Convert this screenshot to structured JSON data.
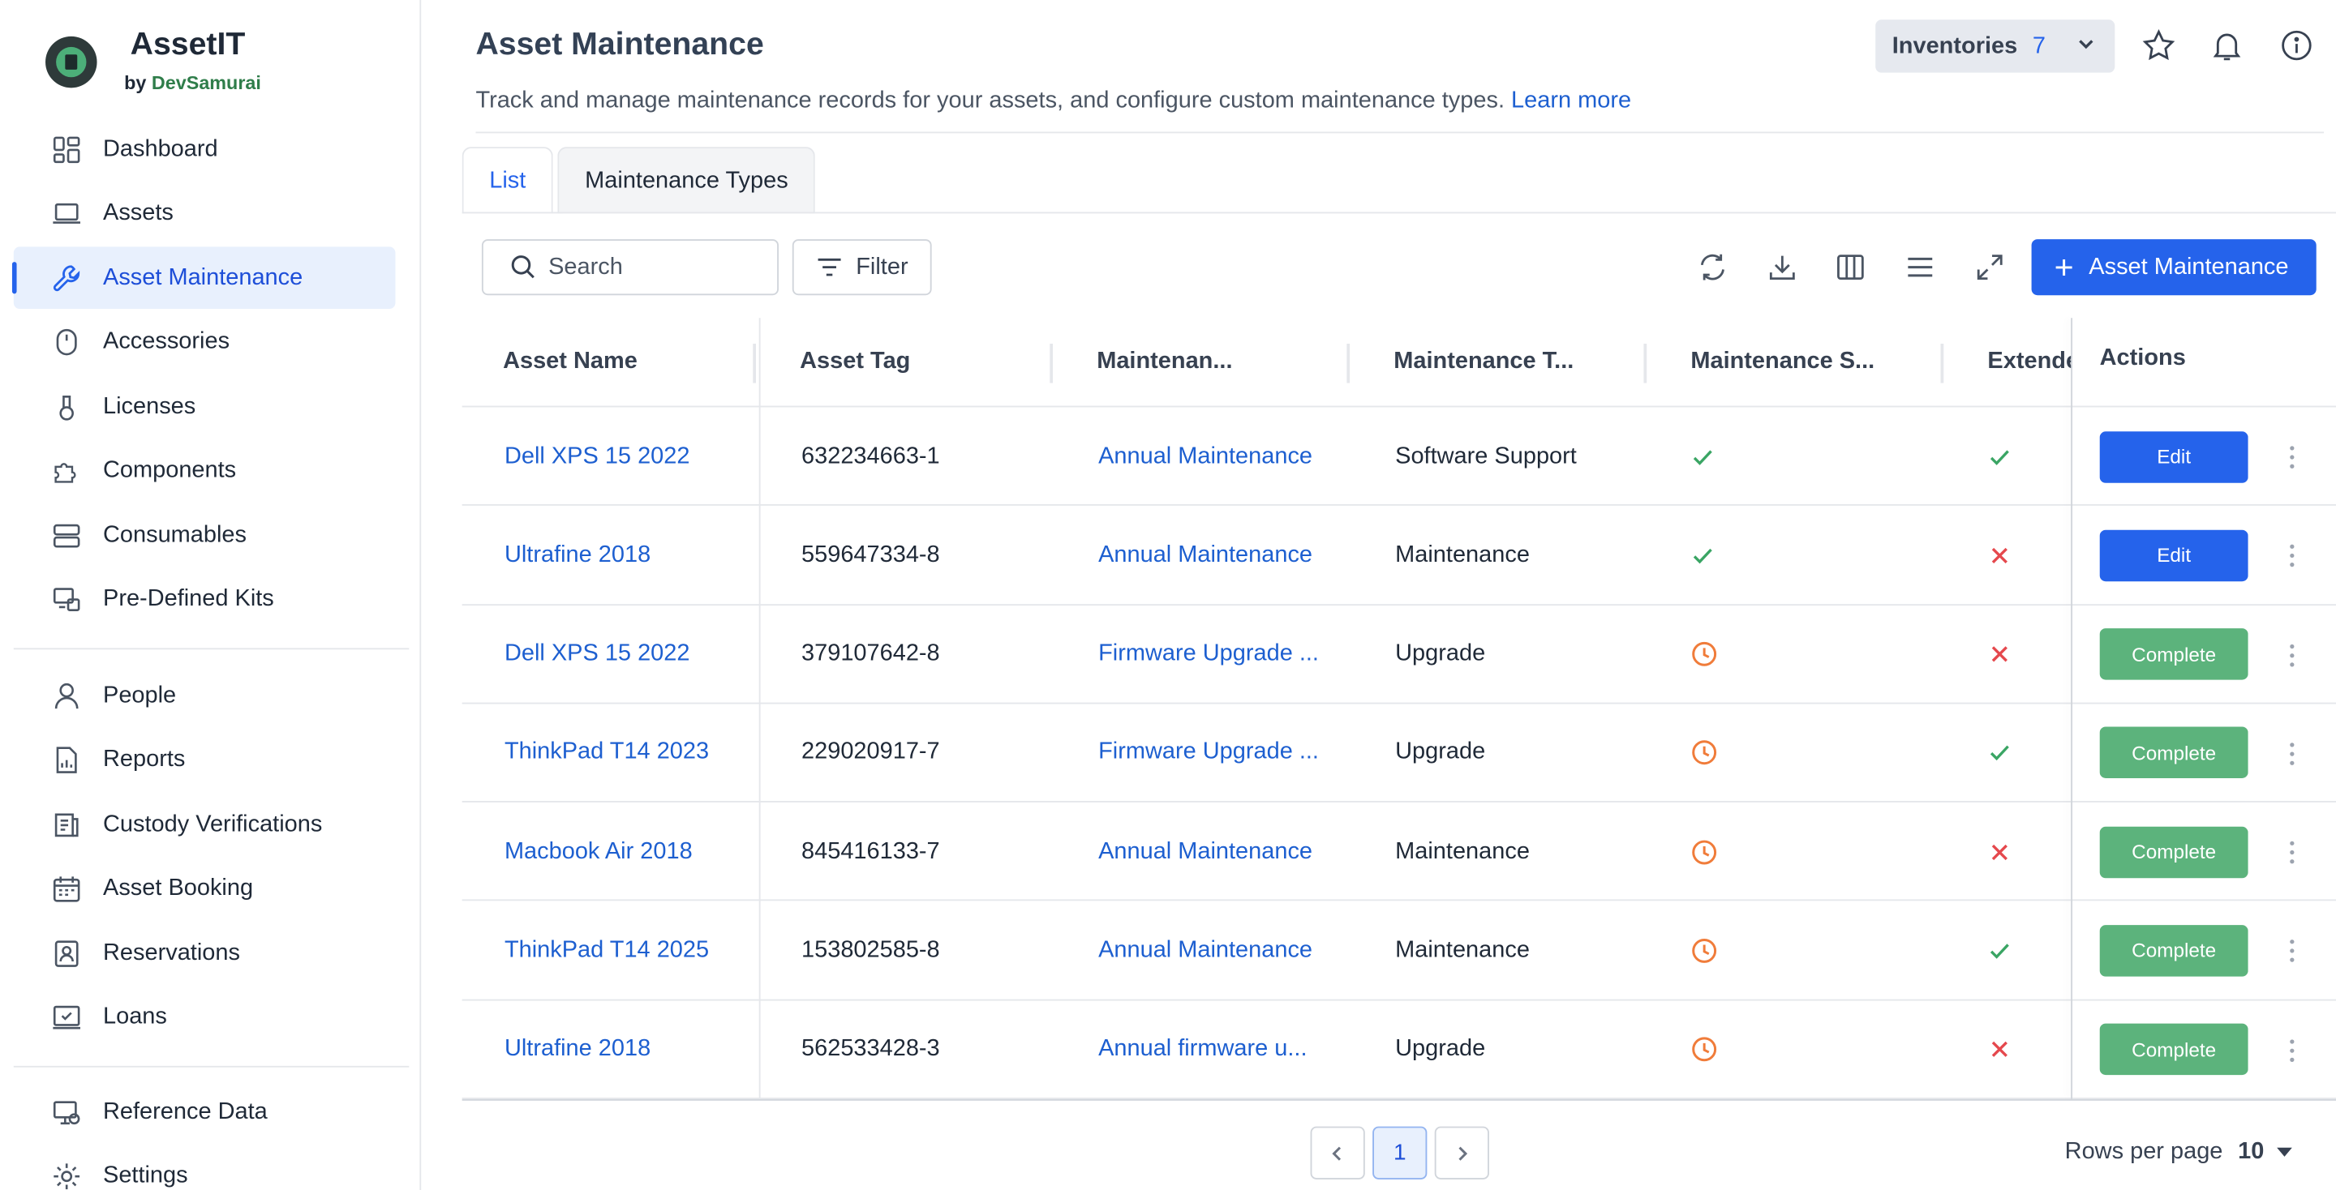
{
  "brand": {
    "name": "AssetIT",
    "by": "by",
    "company": "DevSamurai"
  },
  "sidebar": {
    "items": [
      {
        "label": "Dashboard",
        "icon": "dashboard-icon"
      },
      {
        "label": "Assets",
        "icon": "laptop-icon"
      },
      {
        "label": "Asset Maintenance",
        "icon": "wrench-icon",
        "active": true
      },
      {
        "label": "Accessories",
        "icon": "mouse-icon"
      },
      {
        "label": "Licenses",
        "icon": "license-icon"
      },
      {
        "label": "Components",
        "icon": "puzzle-icon"
      },
      {
        "label": "Consumables",
        "icon": "server-icon"
      },
      {
        "label": "Pre-Defined Kits",
        "icon": "kit-icon"
      }
    ],
    "items2": [
      {
        "label": "People",
        "icon": "person-icon"
      },
      {
        "label": "Reports",
        "icon": "report-icon"
      },
      {
        "label": "Custody Verifications",
        "icon": "verification-icon"
      },
      {
        "label": "Asset Booking",
        "icon": "calendar-icon"
      },
      {
        "label": "Reservations",
        "icon": "reservation-icon"
      },
      {
        "label": "Loans",
        "icon": "loan-icon"
      }
    ],
    "items3": [
      {
        "label": "Reference Data",
        "icon": "reference-icon"
      },
      {
        "label": "Settings",
        "icon": "gear-icon"
      }
    ]
  },
  "header": {
    "title": "Asset Maintenance",
    "description": "Track and manage maintenance records for your assets, and configure custom maintenance types.",
    "learn_more": "Learn more",
    "inventories_label": "Inventories",
    "inventories_count": "7"
  },
  "tabs": [
    {
      "label": "List",
      "active": true
    },
    {
      "label": "Maintenance Types",
      "active": false
    }
  ],
  "toolbar": {
    "search_placeholder": "Search",
    "filter_label": "Filter",
    "add_label": "Asset Maintenance"
  },
  "table": {
    "columns": [
      "Asset Name",
      "Asset Tag",
      "Maintenan...",
      "Maintenance T...",
      "Maintenance S...",
      "Extended",
      "Actions"
    ],
    "rows": [
      {
        "asset_name": "Dell XPS 15 2022",
        "asset_tag": "632234663-1",
        "maintenance": "Annual Maintenance",
        "type": "Software Support",
        "status": "check",
        "extended": "check",
        "action": "Edit"
      },
      {
        "asset_name": "Ultrafine 2018",
        "asset_tag": "559647334-8",
        "maintenance": "Annual Maintenance",
        "type": "Maintenance",
        "status": "check",
        "extended": "cross",
        "action": "Edit"
      },
      {
        "asset_name": "Dell XPS 15 2022",
        "asset_tag": "379107642-8",
        "maintenance": "Firmware Upgrade ...",
        "type": "Upgrade",
        "status": "clock",
        "extended": "cross",
        "action": "Complete"
      },
      {
        "asset_name": "ThinkPad T14 2023",
        "asset_tag": "229020917-7",
        "maintenance": "Firmware Upgrade ...",
        "type": "Upgrade",
        "status": "clock",
        "extended": "check",
        "action": "Complete"
      },
      {
        "asset_name": "Macbook Air 2018",
        "asset_tag": "845416133-7",
        "maintenance": "Annual Maintenance",
        "type": "Maintenance",
        "status": "clock",
        "extended": "cross",
        "action": "Complete"
      },
      {
        "asset_name": "ThinkPad T14 2025",
        "asset_tag": "153802585-8",
        "maintenance": "Annual Maintenance",
        "type": "Maintenance",
        "status": "clock",
        "extended": "check",
        "action": "Complete"
      },
      {
        "asset_name": "Ultrafine 2018",
        "asset_tag": "562533428-3",
        "maintenance": "Annual firmware u...",
        "type": "Upgrade",
        "status": "clock",
        "extended": "cross",
        "action": "Complete"
      }
    ]
  },
  "pagination": {
    "current_page": "1",
    "rows_per_page_label": "Rows per page",
    "rows_per_page": "10"
  },
  "colors": {
    "primary": "#2563eb",
    "complete": "#5cb37c",
    "check": "#3aa564",
    "cross": "#e5484d",
    "clock": "#f07c3a"
  }
}
